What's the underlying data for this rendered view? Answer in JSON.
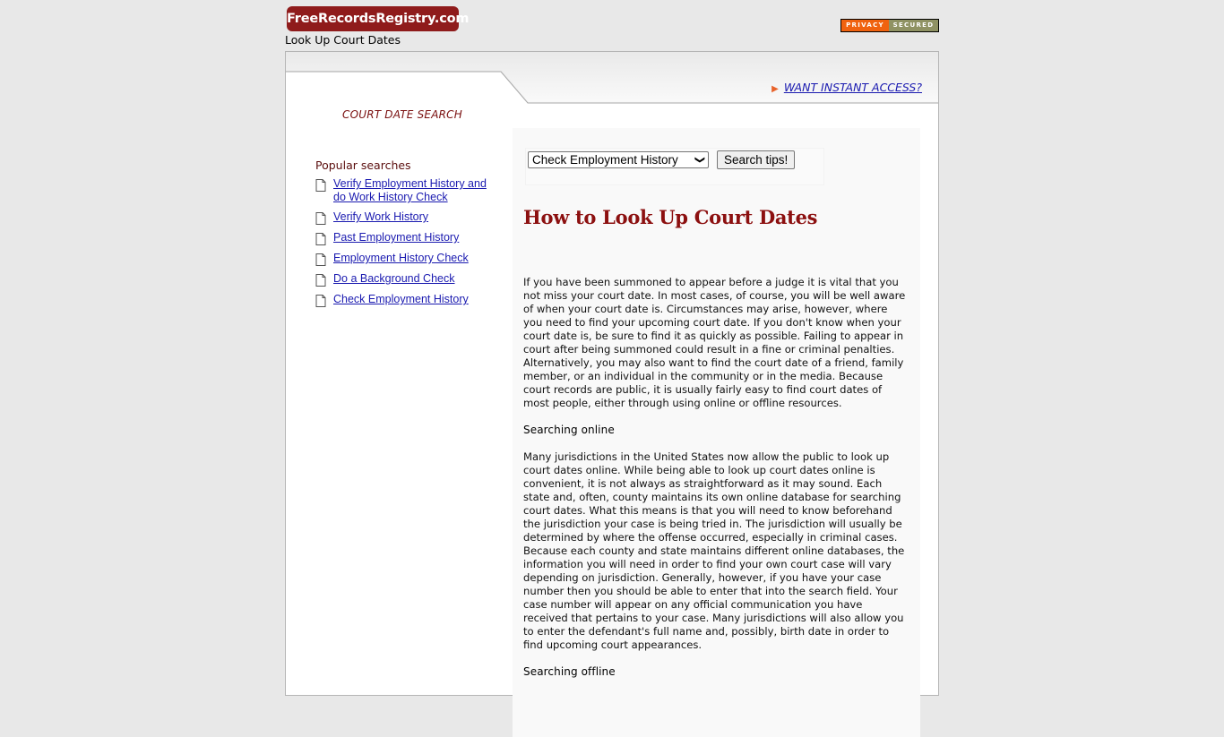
{
  "header": {
    "logo_text": "FreeRecordsRegistry.com",
    "subtitle": "Look Up Court Dates",
    "badge": {
      "left": "PRIVACY",
      "right": "SECURED"
    },
    "access_link": "WANT INSTANT ACCESS?"
  },
  "sidebar": {
    "section_title": "COURT DATE SEARCH",
    "popular_title": "Popular searches",
    "items": [
      {
        "label": "Verify Employment History and do Work History Check"
      },
      {
        "label": "Verify Work History"
      },
      {
        "label": "Past Employment History"
      },
      {
        "label": "Employment History Check"
      },
      {
        "label": "Do a Background Check"
      },
      {
        "label": "Check Employment History"
      }
    ]
  },
  "search": {
    "selected_option": "Check Employment History",
    "button_label": "Search tips!"
  },
  "article": {
    "title": "How to Look Up Court Dates",
    "paragraph_1": "If you have been summoned to appear before a judge it is vital that you not miss your court date. In most cases, of course, you will be well aware of when your court date is. Circumstances may arise, however, where you need to find your upcoming court date. If you don't know when your court date is, be sure to find it as quickly as possible. Failing to appear in court after being summoned could result in a fine or criminal penalties. Alternatively, you may also want to find the court date of a friend, family member, or an individual in the community or in the media. Because court records are public, it is usually fairly easy to find court dates of most people, either through using online or offline resources.",
    "heading_1": "Searching online",
    "paragraph_2": "Many jurisdictions in the United States now allow the public to look up court dates online. While being able to look up court dates online is convenient, it is not always as straightforward as it may sound. Each state and, often, county maintains its own online database for searching court dates. What this means is that you will need to know beforehand the jurisdiction your case is being tried in. The jurisdiction will usually be determined by where the offense occurred, especially in criminal cases. Because each county and state maintains different online databases, the information you will need in order to find your own court case will vary depending on jurisdiction. Generally, however, if you have your case number then you should be able to enter that into the search field. Your case number will appear on any official communication you have received that pertains to your case. Many jurisdictions will also allow you to enter the defendant's full name and, possibly, birth date in order to find upcoming court appearances.",
    "heading_2": "Searching offline"
  },
  "colors": {
    "brand": "#8f1b1b",
    "link": "#1a1ab0",
    "title": "#8c1010",
    "badge_privacy": "#f0620f",
    "badge_secured": "#8f9263"
  },
  "icons": {
    "list_item": "document-icon",
    "access_arrow": "arrow-right-icon",
    "select_chevron": "chevron-down-icon"
  }
}
